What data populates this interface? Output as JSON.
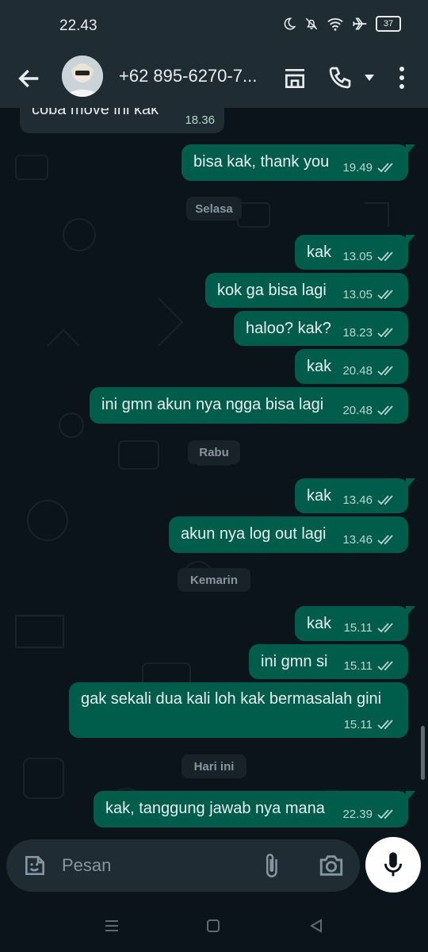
{
  "status_bar": {
    "time": "22.43",
    "battery": "37",
    "icons": [
      "moon-icon",
      "bell-off-icon",
      "wifi-icon",
      "airplane-icon",
      "battery-icon"
    ]
  },
  "header": {
    "contact_name": "+62 895-6270-7...",
    "icons": [
      "back-arrow-icon",
      "avatar",
      "store-icon",
      "phone-icon",
      "dropdown-icon",
      "more-icon"
    ]
  },
  "messages": [
    {
      "dir": "in",
      "text": "coba move ini kak",
      "time": "18.36"
    },
    {
      "dir": "out",
      "text": "bisa kak, thank you",
      "time": "19.49"
    },
    {
      "divider": "Selasa"
    },
    {
      "dir": "out",
      "text": "kak",
      "time": "13.05"
    },
    {
      "dir": "out",
      "text": "kok ga bisa lagi",
      "time": "13.05"
    },
    {
      "dir": "out",
      "text": "haloo? kak?",
      "time": "18.23"
    },
    {
      "dir": "out",
      "text": "kak",
      "time": "20.48"
    },
    {
      "dir": "out",
      "text": "ini gmn akun nya ngga bisa lagi",
      "time": "20.48"
    },
    {
      "divider": "Rabu"
    },
    {
      "dir": "out",
      "text": "kak",
      "time": "13.46"
    },
    {
      "dir": "out",
      "text": "akun nya log out lagi",
      "time": "13.46"
    },
    {
      "divider": "Kemarin"
    },
    {
      "dir": "out",
      "text": "kak",
      "time": "15.11"
    },
    {
      "dir": "out",
      "text": "ini gmn si",
      "time": "15.11"
    },
    {
      "dir": "out",
      "text": "gak sekali dua kali loh kak bermasalah gini",
      "time": "15.11"
    },
    {
      "divider": "Hari ini"
    },
    {
      "dir": "out",
      "text": "kak, tanggung jawab nya mana",
      "time": "22.39"
    }
  ],
  "composer": {
    "placeholder": "Pesan",
    "icons": [
      "sticker-icon",
      "attach-icon",
      "camera-icon",
      "mic-icon"
    ]
  },
  "colors": {
    "outgoing_bubble": "#005c4b",
    "incoming_bubble": "#1f2c34",
    "background": "#0b141a",
    "read_ticks": "#bcd5cf"
  }
}
